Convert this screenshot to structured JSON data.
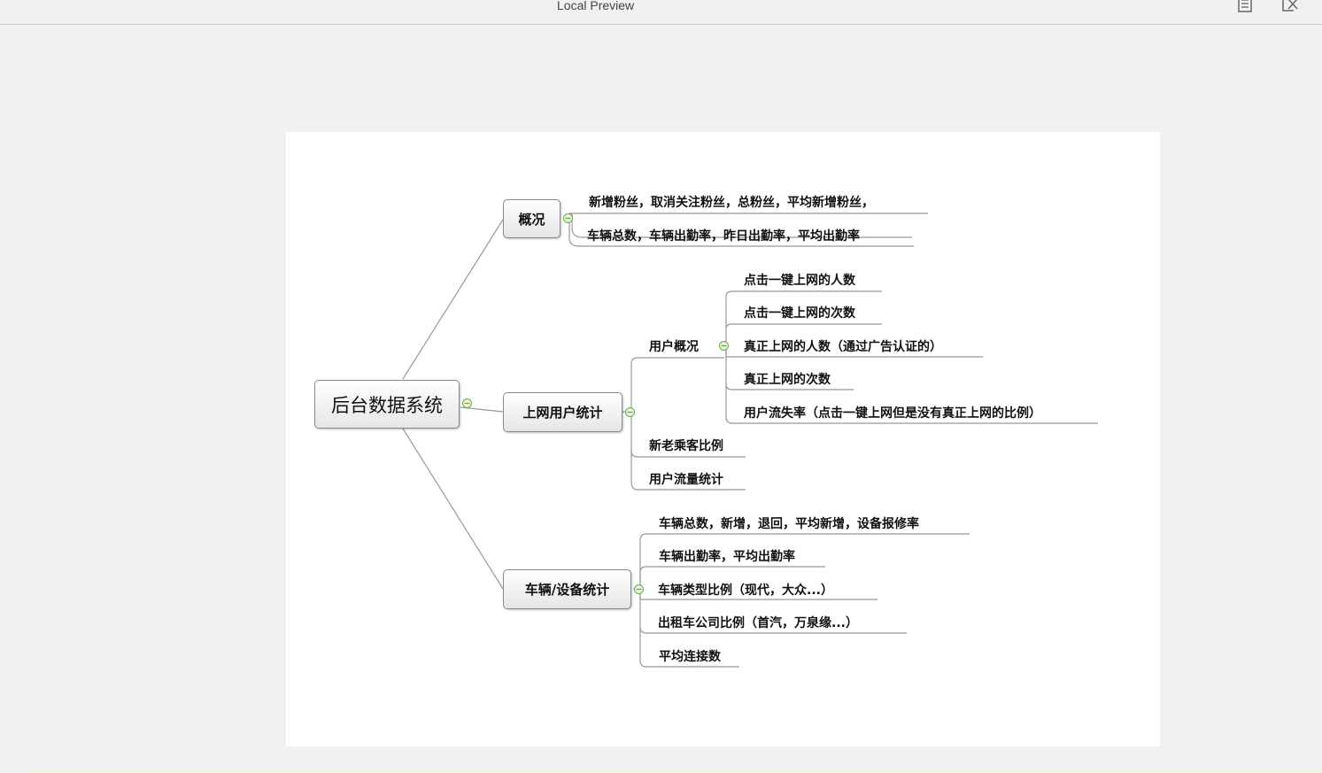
{
  "window": {
    "title": "Local Preview",
    "icons": [
      "document-icon",
      "edit-icon"
    ]
  },
  "mindmap": {
    "root": "后台数据系统",
    "overview": {
      "label": "概况",
      "items": [
        "新增粉丝，取消关注粉丝，总粉丝，平均新增粉丝，",
        "车辆总数，车辆出勤率，昨日出勤率，平均出勤率"
      ]
    },
    "users": {
      "label": "上网用户统计",
      "sub": {
        "label": "用户概况",
        "items": [
          "点击一键上网的人数",
          "点击一键上网的次数",
          "真正上网的人数（通过广告认证的）",
          "真正上网的次数",
          "用户流失率（点击一键上网但是没有真正上网的比例）"
        ]
      },
      "items": [
        "新老乘客比例",
        "用户流量统计"
      ]
    },
    "vehicles": {
      "label": "车辆/设备统计",
      "items": [
        "车辆总数，新增，退回，平均新增，设备报修率",
        "车辆出勤率，平均出勤率",
        "车辆类型比例（现代，大众...）",
        "出租车公司比例（首汽，万泉缘...）",
        "平均连接数"
      ]
    }
  },
  "colors": {
    "toggle": "#6aa84f",
    "connector": "#999999",
    "underline": "#aaaaaa"
  }
}
